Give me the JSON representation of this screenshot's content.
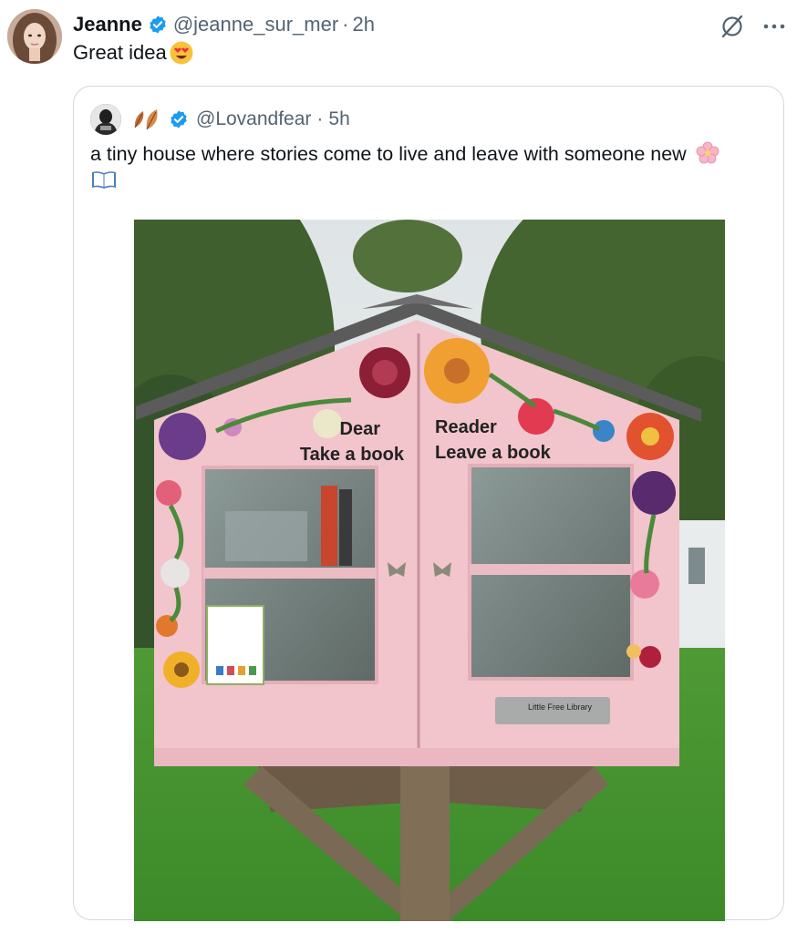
{
  "tweet": {
    "author_name": "Jeanne",
    "author_handle": "@jeanne_sur_mer",
    "separator": "·",
    "time": "2h",
    "text": "Great idea",
    "text_emoji": "heart-eyes"
  },
  "quoted": {
    "author_name_emoji": "leaves",
    "author_handle": "@Lovandfear",
    "separator": "·",
    "time": "5h",
    "text": "a tiny house where stories come to live and leave with someone new",
    "text_emojis": [
      "cherry-blossom",
      "open-book"
    ]
  },
  "photo": {
    "sign_left_line1": "Dear",
    "sign_left_line2": "Take a book",
    "sign_right_line1": "Reader",
    "sign_right_line2": "Leave a book",
    "plaque_title": "Little Free Library"
  },
  "colors": {
    "verified": "#1d9bf0",
    "text_secondary": "#536471",
    "border": "#cfd9de",
    "library_pink": "#f2c4cc"
  },
  "icons": [
    "verified-icon",
    "grok-icon",
    "more-icon"
  ]
}
